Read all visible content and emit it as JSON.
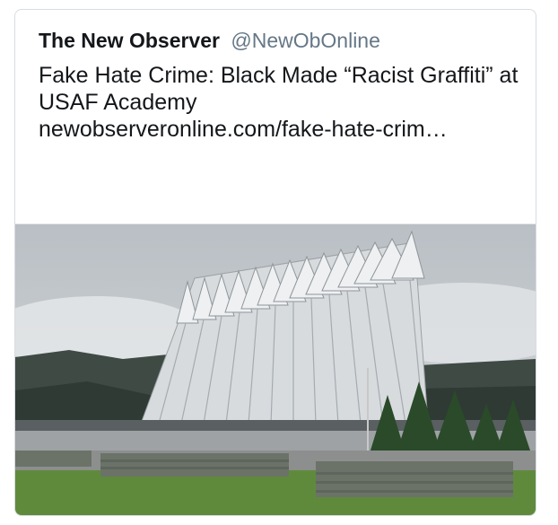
{
  "tweet": {
    "author_name": "The New Observer",
    "author_handle": "@NewObOnline",
    "text": "Fake Hate Crime: Black Made “Racist Graffiti” at USAF Academy",
    "link": "newobserveronline.com/fake-hate-crim…"
  },
  "media": {
    "icon": "photo",
    "sky_color": "#c9ced3",
    "mountain_color": "#3f4a45",
    "grass_color": "#5f8a3c",
    "uniform_color": "#6b7368"
  }
}
